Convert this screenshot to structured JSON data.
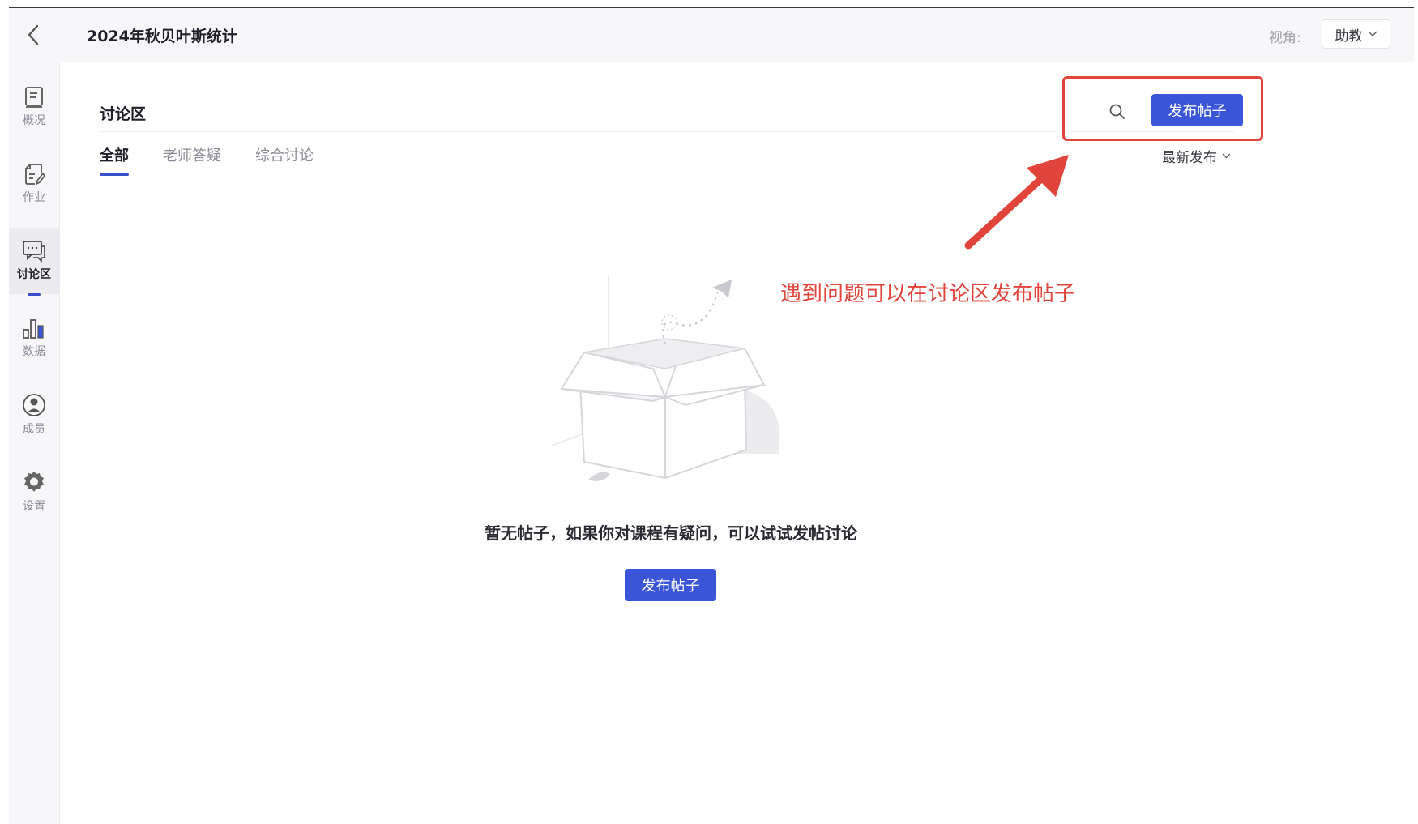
{
  "topbar": {
    "course_title": "2024年秋贝叶斯统计",
    "view_label": "视角:",
    "role_value": "助教"
  },
  "sidebar": {
    "items": [
      {
        "label": "概况",
        "icon": "overview-icon"
      },
      {
        "label": "作业",
        "icon": "homework-icon"
      },
      {
        "label": "讨论区",
        "icon": "discussion-icon",
        "active": true
      },
      {
        "label": "数据",
        "icon": "data-chart-icon"
      },
      {
        "label": "成员",
        "icon": "member-icon"
      },
      {
        "label": "设置",
        "icon": "gear-icon"
      }
    ]
  },
  "main": {
    "section_title": "讨论区",
    "post_button_label": "发布帖子",
    "tabs": [
      {
        "label": "全部",
        "active": true
      },
      {
        "label": "老师答疑"
      },
      {
        "label": "综合讨论"
      }
    ],
    "sort_label": "最新发布",
    "empty_message": "暂无帖子，如果你对课程有疑问，可以试试发帖讨论",
    "empty_post_button_label": "发布帖子"
  },
  "annotation": {
    "text": "遇到问题可以在讨论区发布帖子",
    "color": "#e0443a"
  },
  "colors": {
    "accent": "#3b55d8",
    "highlight": "#e0443a"
  }
}
